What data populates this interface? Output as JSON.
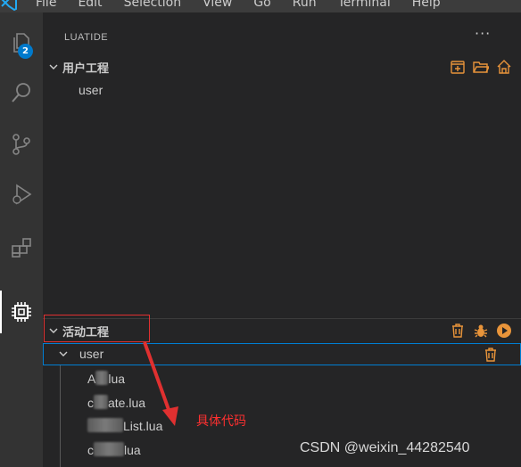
{
  "menubar": {
    "items": [
      "File",
      "Edit",
      "Selection",
      "View",
      "Go",
      "Run",
      "Terminal",
      "Help"
    ]
  },
  "activitybar": {
    "explorer_badge": "2",
    "icons": [
      "files-icon",
      "search-icon",
      "source-control-icon",
      "run-debug-icon",
      "extensions-icon",
      "chip-icon"
    ]
  },
  "sidebar": {
    "title": "LUATIDE",
    "more": "···",
    "user_project": {
      "label": "用户工程",
      "items": [
        "user"
      ]
    },
    "active_project": {
      "label": "活动工程",
      "folder": "user",
      "files": [
        {
          "prefix": "A",
          "suffix": "lua"
        },
        {
          "prefix": "c",
          "suffix": "ate.lua"
        },
        {
          "prefix": "",
          "suffix": "List.lua"
        },
        {
          "prefix": "c",
          "suffix": "lua"
        }
      ]
    }
  },
  "annotation": {
    "text": "具体代码"
  },
  "watermark": "CSDN @weixin_44282540",
  "colors": {
    "accent_orange": "#e8943a",
    "focus_blue": "#007fd4",
    "annotation_red": "#e03030"
  }
}
